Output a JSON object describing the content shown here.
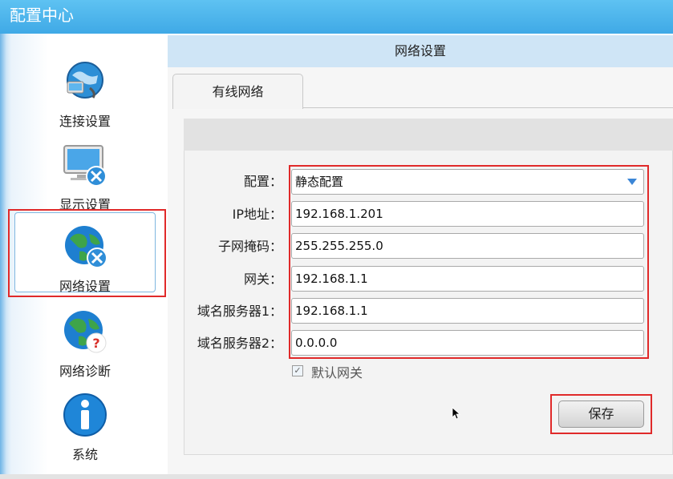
{
  "window": {
    "title": "配置中心"
  },
  "sidebar": {
    "items": [
      {
        "label": "连接设置",
        "icon": "connection-globe-icon"
      },
      {
        "label": "显示设置",
        "icon": "monitor-tools-icon"
      },
      {
        "label": "网络设置",
        "icon": "network-globe-tools-icon",
        "active": true
      },
      {
        "label": "网络诊断",
        "icon": "network-diagnose-globe-icon"
      },
      {
        "label": "系统",
        "icon": "info-icon"
      }
    ]
  },
  "main": {
    "header": "网络设置",
    "tabs": [
      {
        "label": "有线网络",
        "active": true
      }
    ],
    "form": {
      "mode": {
        "label": "配置：",
        "value": "静态配置"
      },
      "ip": {
        "label": "IP地址：",
        "value": "192.168.1.201"
      },
      "subnet": {
        "label": "子网掩码：",
        "value": "255.255.255.0"
      },
      "gateway": {
        "label": "网关：",
        "value": "192.168.1.1"
      },
      "dns1": {
        "label": "域名服务器1：",
        "value": "192.168.1.1"
      },
      "dns2": {
        "label": "域名服务器2：",
        "value": "0.0.0.0"
      },
      "default_gateway": {
        "label": "默认网关",
        "checked": true
      }
    },
    "save_label": "保存"
  },
  "colors": {
    "accent": "#3fa9e6",
    "highlight": "#e02a2a"
  }
}
